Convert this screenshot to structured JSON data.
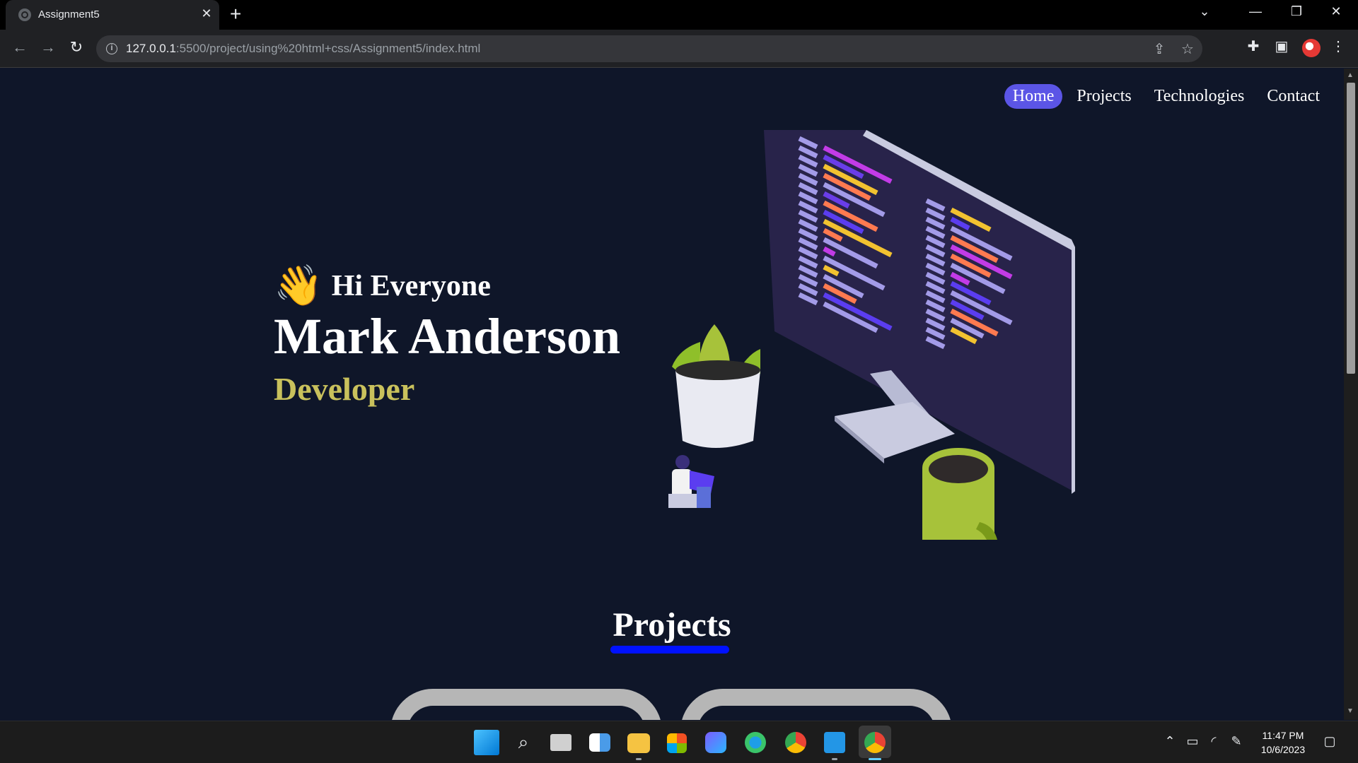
{
  "browser": {
    "tab_title": "Assignment5",
    "tab_close": "✕",
    "new_tab": "+",
    "url_host": "127.0.0.1",
    "url_rest": ":5500/project/using%20html+css/Assignment5/index.html"
  },
  "site": {
    "nav": [
      "Home",
      "Projects",
      "Technologies",
      "Contact"
    ],
    "active_nav": "Home",
    "greeting_emoji": "👋",
    "greeting": "Hi Everyone",
    "name": "Mark Anderson",
    "role": "Developer",
    "section_title": "Projects"
  },
  "colors": {
    "page_bg": "#0f1629",
    "nav_active": "#5b55e6",
    "role_text": "#c9c15c",
    "underline": "#0011ff",
    "card_border": "#b6b6b6"
  },
  "taskbar": {
    "time": "11:47 PM",
    "date": "10/6/2023",
    "apps": [
      "windows-start-icon",
      "search-icon",
      "task-view-icon",
      "widgets-icon",
      "file-explorer-icon",
      "store-icon",
      "copilot-icon",
      "edge-icon",
      "chrome-icon",
      "vscode-icon",
      "chrome-profile-icon"
    ]
  }
}
